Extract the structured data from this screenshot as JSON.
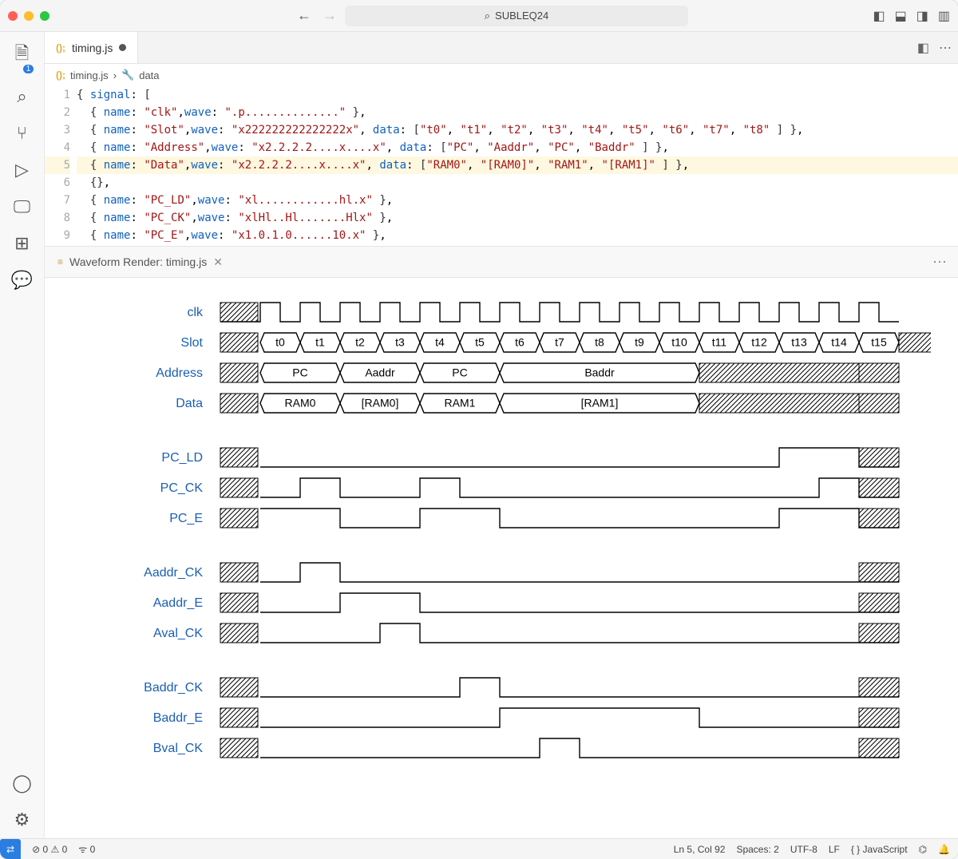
{
  "title": "SUBLEQ24",
  "tab": {
    "name": "timing.js"
  },
  "breadcrumb": {
    "file": "timing.js",
    "symbol": "data"
  },
  "code": {
    "lines": [
      1,
      2,
      3,
      4,
      5,
      6,
      7,
      8,
      9
    ],
    "signals": [
      {
        "name": "clk",
        "wave": ".p.............."
      },
      {
        "name": "Slot",
        "wave": "x222222222222222x",
        "data": [
          "t0",
          "t1",
          "t2",
          "t3",
          "t4",
          "t5",
          "t6",
          "t7",
          "t8"
        ]
      },
      {
        "name": "Address",
        "wave": "x2.2.2.2....x....x",
        "data": [
          "PC",
          "Aaddr",
          "PC",
          "Baddr"
        ]
      },
      {
        "name": "Data",
        "wave": "x2.2.2.2....x....x",
        "data": [
          "RAM0",
          "[RAM0]",
          "RAM1",
          "[RAM1]"
        ]
      },
      {
        "name": "PC_LD",
        "wave": "xl............hl.x"
      },
      {
        "name": "PC_CK",
        "wave": "xlHl..Hl.......Hlx"
      },
      {
        "name": "PC_E",
        "wave": "x1.0.1.0......10.x"
      }
    ]
  },
  "pane2": {
    "title": "Waveform Render: timing.js"
  },
  "waveform": {
    "period": 50,
    "labels": [
      "clk",
      "Slot",
      "Address",
      "Data",
      "",
      "PC_LD",
      "PC_CK",
      "PC_E",
      "",
      "Aaddr_CK",
      "Aaddr_E",
      "Aval_CK",
      "",
      "Baddr_CK",
      "Baddr_E",
      "Bval_CK"
    ],
    "slots": [
      "t0",
      "t1",
      "t2",
      "t3",
      "t4",
      "t5",
      "t6",
      "t7",
      "t8",
      "t9",
      "t10",
      "t11",
      "t12",
      "t13",
      "t14",
      "t15"
    ],
    "address": [
      {
        "span": 2,
        "text": "PC"
      },
      {
        "span": 2,
        "text": "Aaddr"
      },
      {
        "span": 2,
        "text": "PC"
      },
      {
        "span": 5,
        "text": "Baddr"
      },
      {
        "span": 4,
        "text": "",
        "hatch": true
      }
    ],
    "data_bus": [
      {
        "span": 2,
        "text": "RAM0"
      },
      {
        "span": 2,
        "text": "[RAM0]"
      },
      {
        "span": 2,
        "text": "RAM1"
      },
      {
        "span": 5,
        "text": "[RAM1]"
      },
      {
        "span": 4,
        "text": "",
        "hatch": true
      }
    ],
    "PC_LD": "0000000000000110",
    "PC_CK": "0100100000000010",
    "PC_E": "1100110000000110",
    "Aaddr_CK": "0100000000000000",
    "Aaddr_E": "0011000000000000",
    "Aval_CK": "0001000000000000",
    "Baddr_CK": "0000010000000000",
    "Baddr_E": "0000001111100000",
    "Bval_CK": "0000000100000000"
  },
  "status": {
    "errors": "0",
    "warnings": "0",
    "ports": "0",
    "cursor": "Ln 5, Col 92",
    "spaces": "Spaces: 2",
    "encoding": "UTF-8",
    "eol": "LF",
    "lang": "JavaScript"
  }
}
